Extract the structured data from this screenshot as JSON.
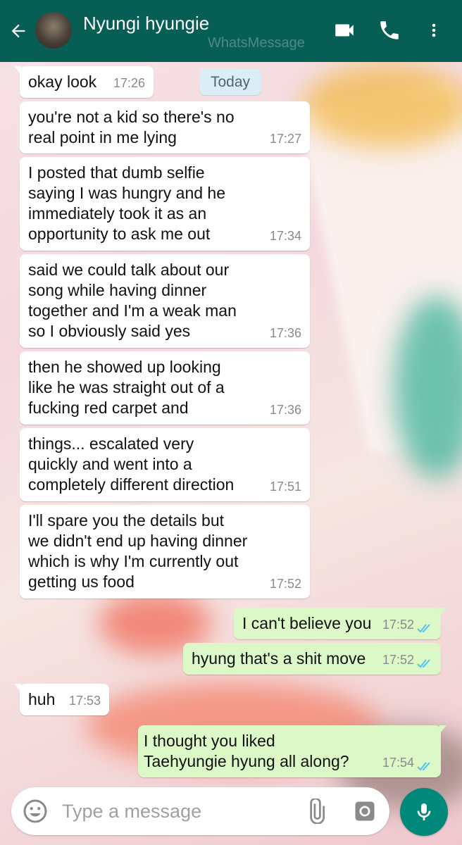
{
  "header": {
    "contact_name": "Nyungi hyungie",
    "watermark": "WhatsMessage",
    "icons": [
      "back-arrow-icon",
      "video-call-icon",
      "phone-icon",
      "more-vert-icon"
    ],
    "color": "#075e54"
  },
  "date_chip": "Today",
  "messages": [
    {
      "dir": "in",
      "text": "okay look",
      "time": "17:26"
    },
    {
      "dir": "in",
      "text": "you're not a kid so there's no\nreal point in me lying",
      "time": "17:27"
    },
    {
      "dir": "in",
      "text": "I posted that dumb selfie\nsaying I was hungry and he\nimmediately took it as an\nopportunity to ask me out",
      "time": "17:34"
    },
    {
      "dir": "in",
      "text": "said we could talk about our\nsong while having dinner\ntogether and I'm a weak man\nso I obviously said yes",
      "time": "17:36"
    },
    {
      "dir": "in",
      "text": "then he showed up looking\nlike he was straight out of a\nfucking red carpet and",
      "time": "17:36"
    },
    {
      "dir": "in",
      "text": "things... escalated very\nquickly and went into a\ncompletely different direction",
      "time": "17:51"
    },
    {
      "dir": "in",
      "text": "I'll spare you the details but\nwe didn't end up having dinner\nwhich is why I'm currently out\ngetting us food",
      "time": "17:52"
    },
    {
      "dir": "out",
      "text": "I can't believe you",
      "time": "17:52",
      "status": "read"
    },
    {
      "dir": "out",
      "text": "hyung that's a shit move",
      "time": "17:52",
      "status": "read"
    },
    {
      "dir": "in",
      "text": "huh",
      "time": "17:53"
    },
    {
      "dir": "out",
      "text": "I thought you liked\nTaehyungie hyung all along?",
      "time": "17:54",
      "status": "read"
    }
  ],
  "composer": {
    "placeholder": "Type a message",
    "icons": [
      "emoji-icon",
      "attach-icon",
      "camera-icon",
      "mic-icon"
    ]
  },
  "colors": {
    "outgoing": "#dcf8c6",
    "incoming": "#ffffff",
    "ticks": "#4fc3f7",
    "send": "#00897b"
  }
}
